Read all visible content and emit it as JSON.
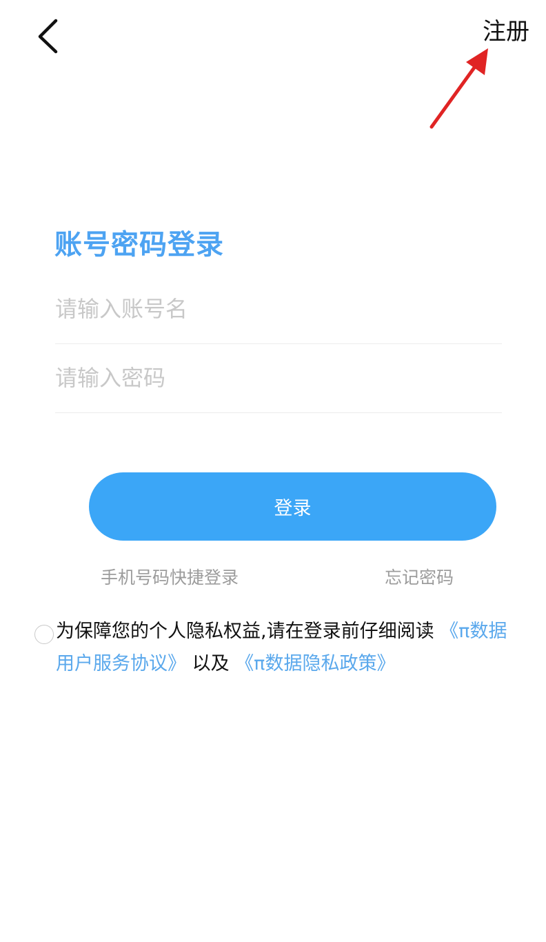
{
  "header": {
    "back_icon": "chevron-left-icon",
    "register_label": "注册"
  },
  "login": {
    "title": "账号密码登录",
    "account_placeholder": "请输入账号名",
    "password_placeholder": "请输入密码",
    "submit_label": "登录",
    "phone_login_label": "手机号码快捷登录",
    "forgot_password_label": "忘记密码"
  },
  "agreement": {
    "checked": false,
    "prefix": "为保障您的个人隐私权益,请在登录前仔细阅读",
    "user_agreement_link": "《π数据用户服务协议》",
    "conjunction": "以及",
    "privacy_policy_link": "《π数据隐私政策》"
  },
  "colors": {
    "accent": "#3ba6f7",
    "title": "#4da3f2",
    "link": "#5aa8ec",
    "secondary_text": "#9c9c9c",
    "annotation_arrow": "#e02424"
  }
}
